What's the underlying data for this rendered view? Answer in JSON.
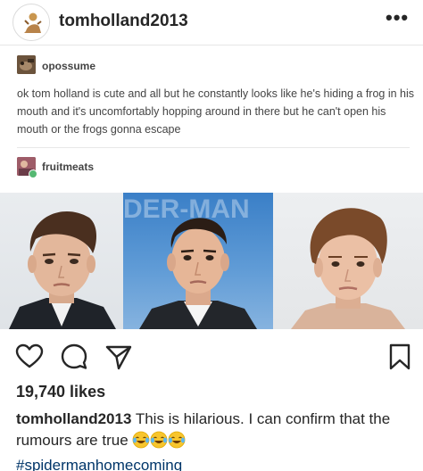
{
  "header": {
    "username": "tomholland2013",
    "more_label": "•••"
  },
  "tumblr": {
    "op_username": "opossume",
    "op_text": "ok tom holland is cute and all but he constantly looks like he's hiding a frog in his mouth and it's uncomfortably hopping around in there but he can't open his mouth or the frogs gonna escape",
    "reblog_username": "fruitmeats",
    "photo_backdrop_text": "DER-MAN"
  },
  "post": {
    "likes": "19,740 likes",
    "caption_user": "tomholland2013",
    "caption_text": "This is hilarious. I can confirm that the rumours are true",
    "hashtag": "#spidermanhomecoming",
    "emoji_count": 3,
    "emoji_name": "face-with-tears-of-joy"
  },
  "icons": {
    "like": "heart-icon",
    "comment": "comment-icon",
    "share": "share-icon",
    "save": "bookmark-icon"
  },
  "colors": {
    "text": "#262626",
    "hashtag": "#003569",
    "tumblr_text": "#444444"
  }
}
